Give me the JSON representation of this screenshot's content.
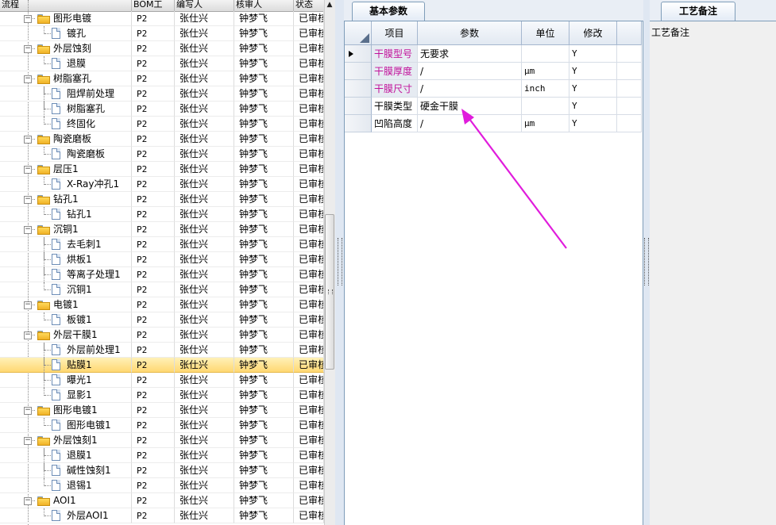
{
  "left_tree": {
    "columns": [
      "流程",
      "BOM工",
      "编写人",
      "核审人",
      "状态"
    ],
    "rows": [
      {
        "level": 0,
        "label": "图形电镀",
        "bom": "P2",
        "writer": "张仕兴",
        "reviewer": "钟梦飞",
        "status": "已审核"
      },
      {
        "level": 1,
        "label": "镀孔",
        "bom": "P2",
        "writer": "张仕兴",
        "reviewer": "钟梦飞",
        "status": "已审核"
      },
      {
        "level": 0,
        "label": "外层蚀刻",
        "bom": "P2",
        "writer": "张仕兴",
        "reviewer": "钟梦飞",
        "status": "已审核"
      },
      {
        "level": 1,
        "label": "退膜",
        "bom": "P2",
        "writer": "张仕兴",
        "reviewer": "钟梦飞",
        "status": "已审核"
      },
      {
        "level": 0,
        "label": "树脂塞孔",
        "bom": "P2",
        "writer": "张仕兴",
        "reviewer": "钟梦飞",
        "status": "已审核"
      },
      {
        "level": 1,
        "label": "阻焊前处理",
        "bom": "P2",
        "writer": "张仕兴",
        "reviewer": "钟梦飞",
        "status": "已审核"
      },
      {
        "level": 1,
        "label": "树脂塞孔",
        "bom": "P2",
        "writer": "张仕兴",
        "reviewer": "钟梦飞",
        "status": "已审核"
      },
      {
        "level": 1,
        "label": "终固化",
        "bom": "P2",
        "writer": "张仕兴",
        "reviewer": "钟梦飞",
        "status": "已审核"
      },
      {
        "level": 0,
        "label": "陶瓷磨板",
        "bom": "P2",
        "writer": "张仕兴",
        "reviewer": "钟梦飞",
        "status": "已审核"
      },
      {
        "level": 1,
        "label": "陶瓷磨板",
        "bom": "P2",
        "writer": "张仕兴",
        "reviewer": "钟梦飞",
        "status": "已审核"
      },
      {
        "level": 0,
        "label": "层压1",
        "bom": "P2",
        "writer": "张仕兴",
        "reviewer": "钟梦飞",
        "status": "已审核"
      },
      {
        "level": 1,
        "label": "X-Ray冲孔1",
        "bom": "P2",
        "writer": "张仕兴",
        "reviewer": "钟梦飞",
        "status": "已审核"
      },
      {
        "level": 0,
        "label": "钻孔1",
        "bom": "P2",
        "writer": "张仕兴",
        "reviewer": "钟梦飞",
        "status": "已审核"
      },
      {
        "level": 1,
        "label": "钻孔1",
        "bom": "P2",
        "writer": "张仕兴",
        "reviewer": "钟梦飞",
        "status": "已审核"
      },
      {
        "level": 0,
        "label": "沉铜1",
        "bom": "P2",
        "writer": "张仕兴",
        "reviewer": "钟梦飞",
        "status": "已审核"
      },
      {
        "level": 1,
        "label": "去毛刺1",
        "bom": "P2",
        "writer": "张仕兴",
        "reviewer": "钟梦飞",
        "status": "已审核"
      },
      {
        "level": 1,
        "label": "烘板1",
        "bom": "P2",
        "writer": "张仕兴",
        "reviewer": "钟梦飞",
        "status": "已审核"
      },
      {
        "level": 1,
        "label": "等离子处理1",
        "bom": "P2",
        "writer": "张仕兴",
        "reviewer": "钟梦飞",
        "status": "已审核"
      },
      {
        "level": 1,
        "label": "沉铜1",
        "bom": "P2",
        "writer": "张仕兴",
        "reviewer": "钟梦飞",
        "status": "已审核"
      },
      {
        "level": 0,
        "label": "电镀1",
        "bom": "P2",
        "writer": "张仕兴",
        "reviewer": "钟梦飞",
        "status": "已审核"
      },
      {
        "level": 1,
        "label": "板镀1",
        "bom": "P2",
        "writer": "张仕兴",
        "reviewer": "钟梦飞",
        "status": "已审核"
      },
      {
        "level": 0,
        "label": "外层干膜1",
        "bom": "P2",
        "writer": "张仕兴",
        "reviewer": "钟梦飞",
        "status": "已审核"
      },
      {
        "level": 1,
        "label": "外层前处理1",
        "bom": "P2",
        "writer": "张仕兴",
        "reviewer": "钟梦飞",
        "status": "已审核"
      },
      {
        "level": 1,
        "label": "贴膜1",
        "bom": "P2",
        "writer": "张仕兴",
        "reviewer": "钟梦飞",
        "status": "已审核",
        "selected": true
      },
      {
        "level": 1,
        "label": "曝光1",
        "bom": "P2",
        "writer": "张仕兴",
        "reviewer": "钟梦飞",
        "status": "已审核"
      },
      {
        "level": 1,
        "label": "显影1",
        "bom": "P2",
        "writer": "张仕兴",
        "reviewer": "钟梦飞",
        "status": "已审核"
      },
      {
        "level": 0,
        "label": "图形电镀1",
        "bom": "P2",
        "writer": "张仕兴",
        "reviewer": "钟梦飞",
        "status": "已审核"
      },
      {
        "level": 1,
        "label": "图形电镀1",
        "bom": "P2",
        "writer": "张仕兴",
        "reviewer": "钟梦飞",
        "status": "已审核"
      },
      {
        "level": 0,
        "label": "外层蚀刻1",
        "bom": "P2",
        "writer": "张仕兴",
        "reviewer": "钟梦飞",
        "status": "已审核"
      },
      {
        "level": 1,
        "label": "退膜1",
        "bom": "P2",
        "writer": "张仕兴",
        "reviewer": "钟梦飞",
        "status": "已审核"
      },
      {
        "level": 1,
        "label": "碱性蚀刻1",
        "bom": "P2",
        "writer": "张仕兴",
        "reviewer": "钟梦飞",
        "status": "已审核"
      },
      {
        "level": 1,
        "label": "退锡1",
        "bom": "P2",
        "writer": "张仕兴",
        "reviewer": "钟梦飞",
        "status": "已审核"
      },
      {
        "level": 0,
        "label": "AOI1",
        "bom": "P2",
        "writer": "张仕兴",
        "reviewer": "钟梦飞",
        "status": "已审核"
      },
      {
        "level": 1,
        "label": "外层AOI1",
        "bom": "P2",
        "writer": "张仕兴",
        "reviewer": "钟梦飞",
        "status": "已审核"
      }
    ]
  },
  "params_panel": {
    "tab_label": "基本参数",
    "columns": [
      "项目",
      "参数",
      "单位",
      "修改"
    ],
    "rows": [
      {
        "item": "干膜型号",
        "param": "无要求",
        "unit": "",
        "modify": "Y",
        "highlight": true,
        "current": true
      },
      {
        "item": "干膜厚度",
        "param": "/",
        "unit": "μm",
        "modify": "Y",
        "highlight": true
      },
      {
        "item": "干膜尺寸",
        "param": "/",
        "unit": "inch",
        "modify": "Y",
        "highlight": true
      },
      {
        "item": "干膜类型",
        "param": "硬金干膜",
        "unit": "",
        "modify": "Y",
        "highlight": false
      },
      {
        "item": "凹陷高度",
        "param": "/",
        "unit": "μm",
        "modify": "Y",
        "highlight": false
      }
    ]
  },
  "notes_panel": {
    "tab_label": "工艺备注",
    "field_label": "工艺备注"
  },
  "colors": {
    "selected_row": "#ffd66e",
    "highlight_text": "#c1109a",
    "annotation_arrow": "#e01cdc"
  },
  "icons": {
    "expander": "collapse-minus-icon",
    "group": "folder-icon",
    "leaf": "document-icon",
    "row_indicator": "row-pointer-icon",
    "arrow": "annotation-arrow-icon"
  }
}
